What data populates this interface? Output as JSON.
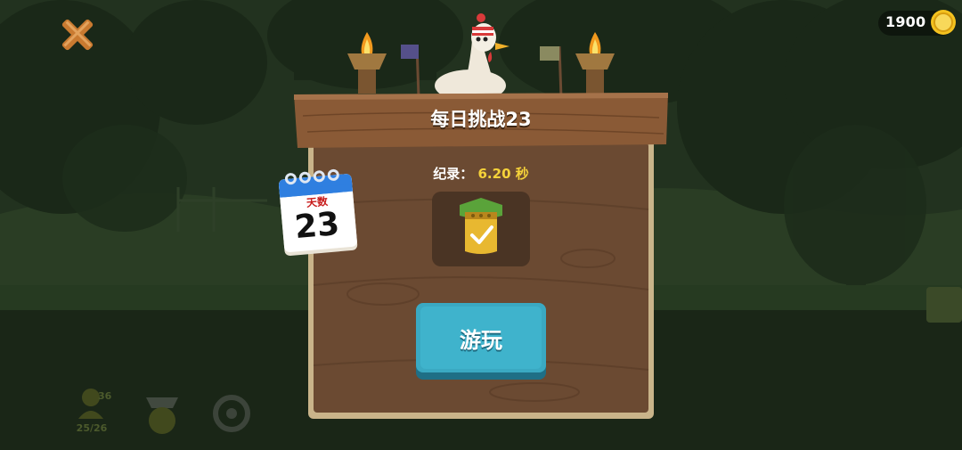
{
  "coins": {
    "amount": "1900",
    "icon": "coin-icon"
  },
  "dialog": {
    "title": "每日挑战23",
    "record_label": "纪录：",
    "record_value": "6.20 秒",
    "play_label": "游玩"
  },
  "calendar": {
    "label": "天数",
    "day": "23"
  },
  "bottom_bar": {
    "character_count": "36",
    "progress": "25/26"
  },
  "colors": {
    "wood": "#6b4a32",
    "plank": "#8a5a36",
    "play_button": "#3aa9c2",
    "record_value": "#f5d23a",
    "medal_green": "#5aa33a",
    "medal_gold": "#e8b830"
  }
}
